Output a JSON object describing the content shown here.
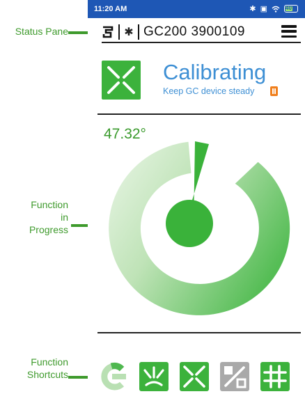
{
  "annotations": {
    "status_pane": "Status Pane",
    "function_in_progress": [
      "Function",
      "in",
      "Progress"
    ],
    "function_shortcuts": [
      "Function",
      "Shortcuts"
    ]
  },
  "statusbar": {
    "time": "11:20 AM",
    "battery": "40",
    "icons": [
      "bluetooth-icon",
      "screen-icon",
      "wifi-icon",
      "battery-icon"
    ]
  },
  "status_pane": {
    "device_icon": "device-link-icon",
    "bluetooth_glyph": "✱",
    "device_id": "GC200 3900109",
    "menu_icon": "hamburger-menu-icon"
  },
  "function": {
    "icon": "calibration-x-icon",
    "title": "Calibrating",
    "subtitle": "Keep GC device steady",
    "warning_icon": "battery-warning-icon"
  },
  "gauge": {
    "angle_label": "47.32°",
    "angle_value": 47.32,
    "needle_icon": "needle-icon"
  },
  "shortcuts": [
    {
      "name": "calibrate-c-icon",
      "state": "active"
    },
    {
      "name": "sparkle-icon",
      "state": "enabled"
    },
    {
      "name": "x-cross-icon",
      "state": "enabled"
    },
    {
      "name": "percent-icon",
      "state": "disabled"
    },
    {
      "name": "grid-icon",
      "state": "enabled"
    }
  ],
  "colors": {
    "annotation_green": "#3e9a2c",
    "status_bar_blue": "#1e57b5",
    "title_blue": "#3d8fd4",
    "brand_green": "#3cb23c",
    "gauge_light": "#d6eed2",
    "gauge_dark": "#55bd55",
    "disabled_grey": "#a9a9a9",
    "warning_orange": "#f07f1c"
  }
}
